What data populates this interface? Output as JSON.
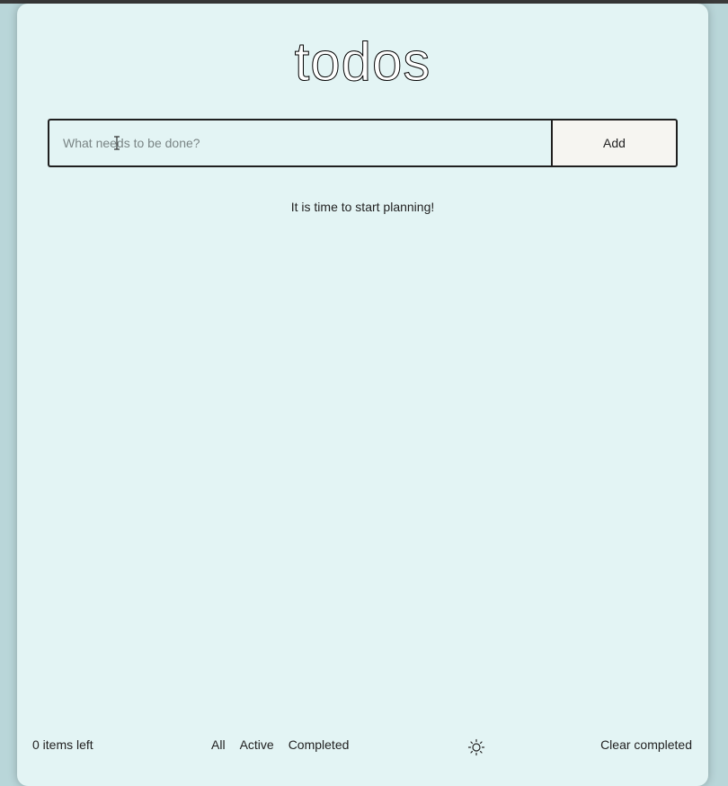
{
  "app": {
    "title": "todos"
  },
  "new_todo": {
    "placeholder": "What needs to be done?",
    "value": "",
    "add_label": "Add"
  },
  "list": {
    "empty_message": "It is time to start planning!",
    "items": []
  },
  "footer": {
    "items_left": "0 items left",
    "filters": [
      "All",
      "Active",
      "Completed"
    ],
    "theme_icon": "sun-icon",
    "clear_completed": "Clear completed"
  },
  "colors": {
    "card_background": "#e3f4f4",
    "page_background": "#b9d6d9",
    "button_background": "#f6f5f1",
    "border": "#1f1f1f"
  }
}
